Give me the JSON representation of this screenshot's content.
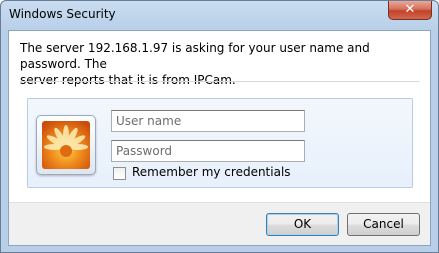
{
  "window": {
    "title": "Windows Security"
  },
  "message": {
    "line1": "The server 192.168.1.97 is asking for your user name and password. The",
    "line2": "server reports that it is from IPCam."
  },
  "credentials": {
    "username_placeholder": "User name",
    "password_placeholder": "Password",
    "remember_label": "Remember my credentials",
    "remember_checked": false,
    "user_tile_icon": "flower-user-tile-icon"
  },
  "buttons": {
    "ok_label": "OK",
    "cancel_label": "Cancel"
  },
  "icons": {
    "close": "close-icon"
  },
  "colors": {
    "close_button": "#c1442b",
    "frame": "#b7cfe8",
    "panel": "#e7f0fb"
  }
}
